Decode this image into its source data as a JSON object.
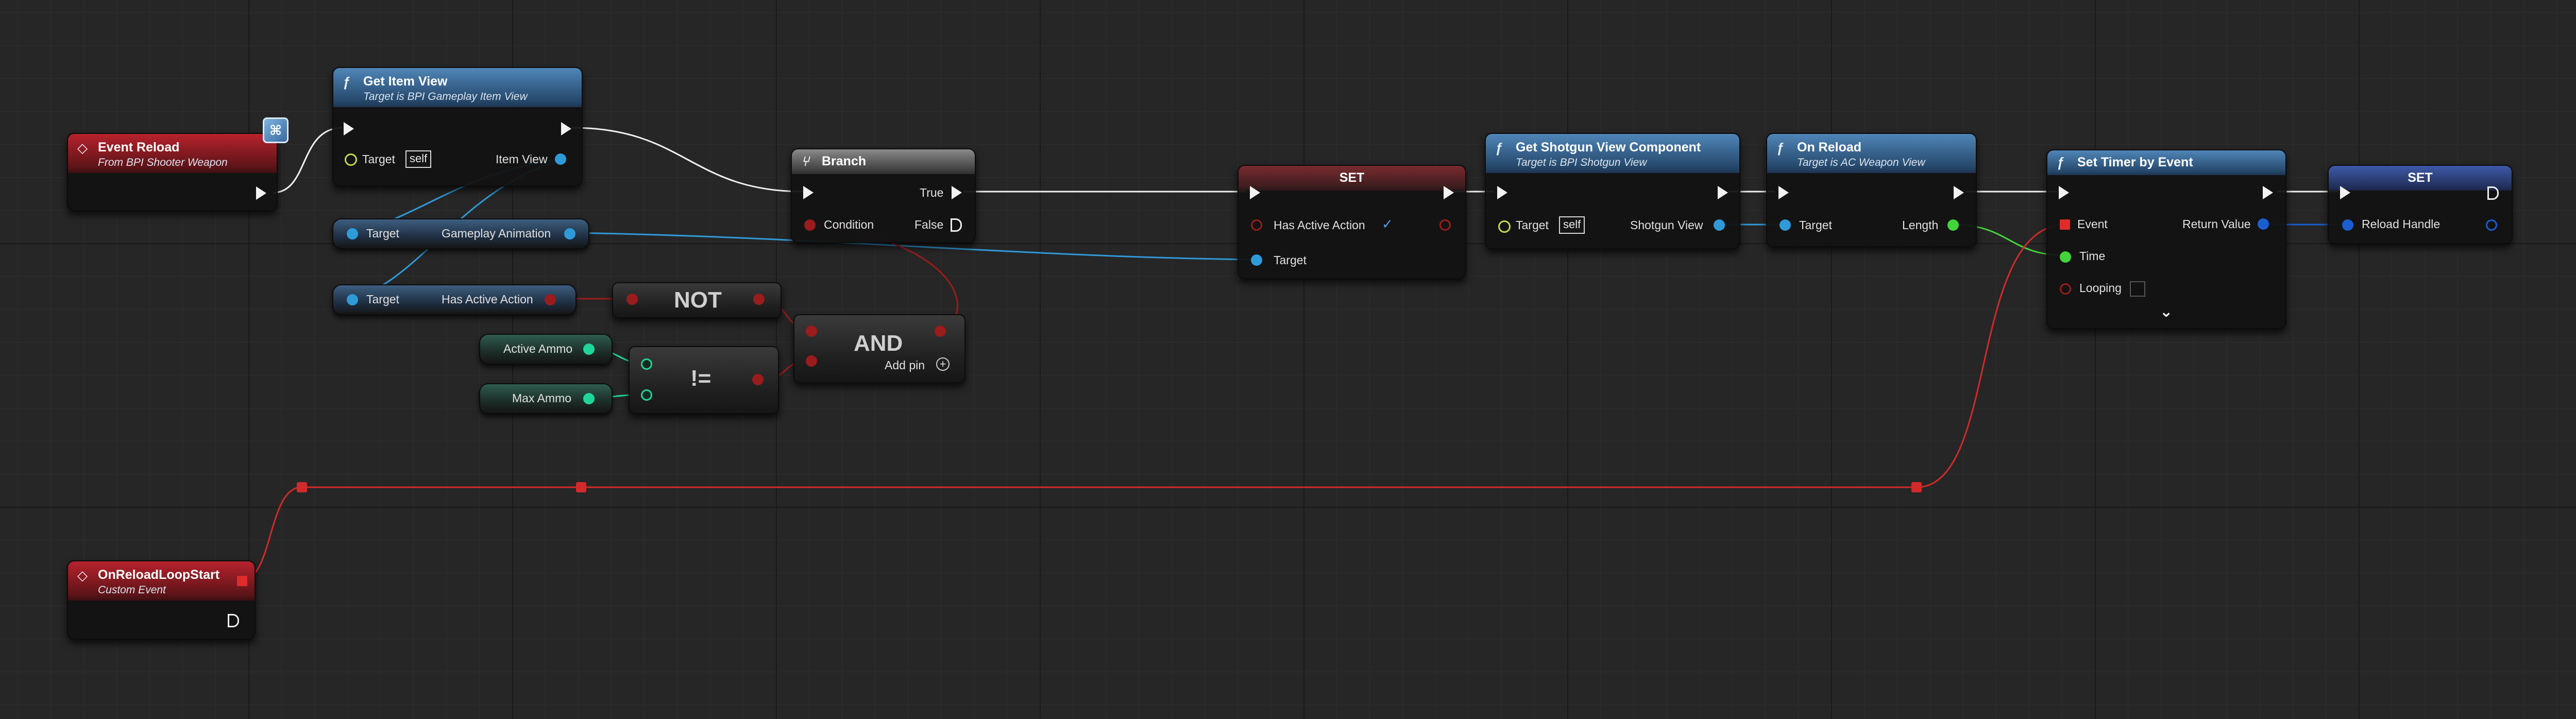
{
  "nodes": {
    "event_reload": {
      "title": "Event Reload",
      "subtitle": "From BPI Shooter Weapon"
    },
    "get_item_view": {
      "title": "Get Item View",
      "subtitle": "Target is BPI Gameplay Item View",
      "target_label": "Target",
      "self_value": "self",
      "output_label": "Item View"
    },
    "gameplay_animation": {
      "target_label": "Target",
      "output_label": "Gameplay Animation"
    },
    "has_active_action_get": {
      "target_label": "Target",
      "output_label": "Has Active Action"
    },
    "not_node": {
      "label": "NOT"
    },
    "active_ammo": {
      "label": "Active Ammo"
    },
    "max_ammo": {
      "label": "Max Ammo"
    },
    "not_equal": {
      "label": "!="
    },
    "and_node": {
      "label": "AND",
      "add_pin_label": "Add pin"
    },
    "branch": {
      "title": "Branch",
      "condition_label": "Condition",
      "true_label": "True",
      "false_label": "False"
    },
    "set_has_active_action": {
      "title": "SET",
      "input_label": "Has Active Action",
      "target_label": "Target"
    },
    "get_shotgun_view": {
      "title": "Get Shotgun View Component",
      "subtitle": "Target is BPI Shotgun View",
      "target_label": "Target",
      "self_value": "self",
      "output_label": "Shotgun View"
    },
    "on_reload": {
      "title": "On Reload",
      "subtitle": "Target is AC Weapon View",
      "target_label": "Target",
      "output_label": "Length"
    },
    "set_timer": {
      "title": "Set Timer by Event",
      "event_label": "Event",
      "time_label": "Time",
      "looping_label": "Looping",
      "return_label": "Return Value"
    },
    "set_reload_handle": {
      "title": "SET",
      "input_label": "Reload Handle"
    },
    "on_reload_loop_start": {
      "title": "OnReloadLoopStart",
      "subtitle": "Custom Event"
    }
  },
  "icons": {
    "function": "function-icon",
    "event": "event-diamond-icon",
    "branch": "branch-icon",
    "interface": "interface-badge-icon",
    "expand": "chevron-down-icon",
    "checked": "checkmark-icon",
    "add": "add-pin-icon"
  },
  "colors": {
    "background": "#262626",
    "exec": "#f2f2f2",
    "object_pin": "#2f9ad8",
    "bool_pin": "#9b1c1c",
    "int_pin": "#1fd69a",
    "float_pin": "#42d43a",
    "delegate_pin": "#e02b2b",
    "struct_pin": "#1a5ed0",
    "event_header": "#b8222c",
    "function_header": "#4f86b8"
  }
}
